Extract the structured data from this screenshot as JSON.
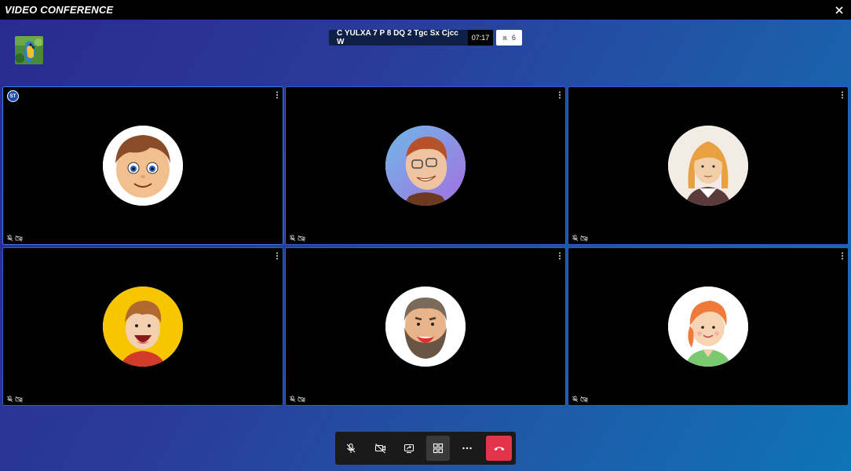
{
  "window": {
    "title": "VIDEO CONFERENCE"
  },
  "meeting": {
    "name": "C YULXA 7 P 8 DQ 2 Tgc Sx Cjcc W",
    "duration": "07:17",
    "participant_count": "6"
  },
  "participants": [
    {
      "avatar": "boy-brown-hair-avatar",
      "badge": "ST",
      "active": true
    },
    {
      "avatar": "man-glasses-avatar"
    },
    {
      "avatar": "woman-blonde-avatar"
    },
    {
      "avatar": "boy-yellow-bg-avatar"
    },
    {
      "avatar": "bearded-man-avatar"
    },
    {
      "avatar": "girl-red-hair-avatar"
    }
  ],
  "controls": [
    "mic-off-icon",
    "camera-off-icon",
    "screen-share-icon",
    "grid-layout-icon",
    "more-icon",
    "hang-up-icon"
  ],
  "colors": {
    "hangup": "#e0354b",
    "tile_border": "#2c5fc9"
  }
}
